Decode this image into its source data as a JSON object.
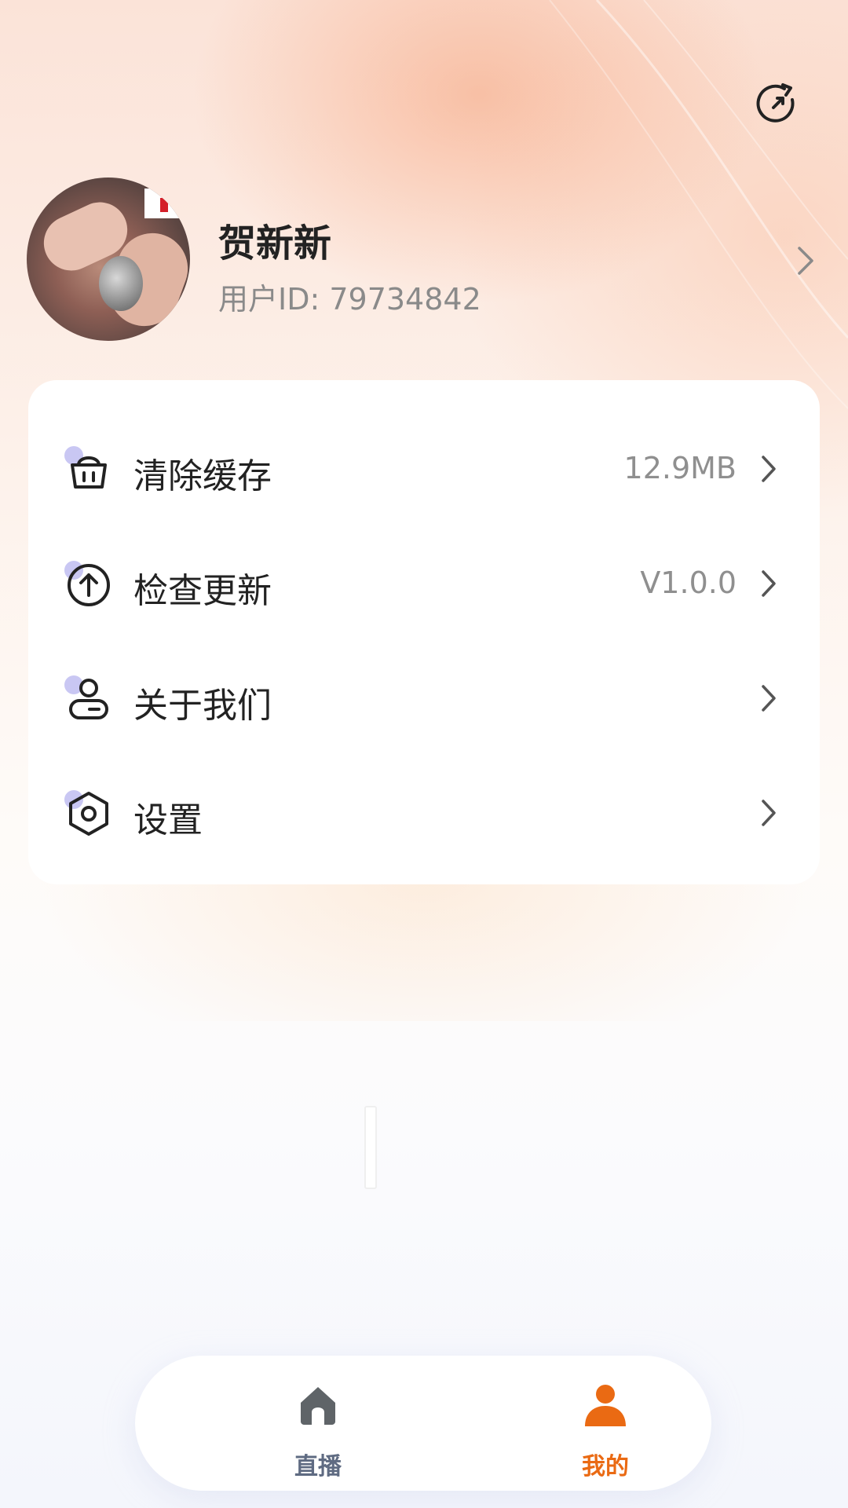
{
  "profile": {
    "name": "贺新新",
    "user_id": "用户ID: 79734842"
  },
  "menu": [
    {
      "label": "清除缓存",
      "value": "12.9MB",
      "icon": "basket-icon"
    },
    {
      "label": "检查更新",
      "value": "V1.0.0",
      "icon": "upload-arrow-circle-icon"
    },
    {
      "label": "关于我们",
      "value": "",
      "icon": "user-card-icon"
    },
    {
      "label": "设置",
      "value": "",
      "icon": "hexagon-settings-icon"
    }
  ],
  "tabbar": {
    "tabs": [
      {
        "label": "直播",
        "icon": "home-icon",
        "active": false
      },
      {
        "label": "我的",
        "icon": "person-icon",
        "active": true
      }
    ]
  },
  "colors": {
    "accent": "#ea6a13",
    "inactive_tab": "#5f6b82",
    "icon_dot": "#c9c7f3"
  }
}
